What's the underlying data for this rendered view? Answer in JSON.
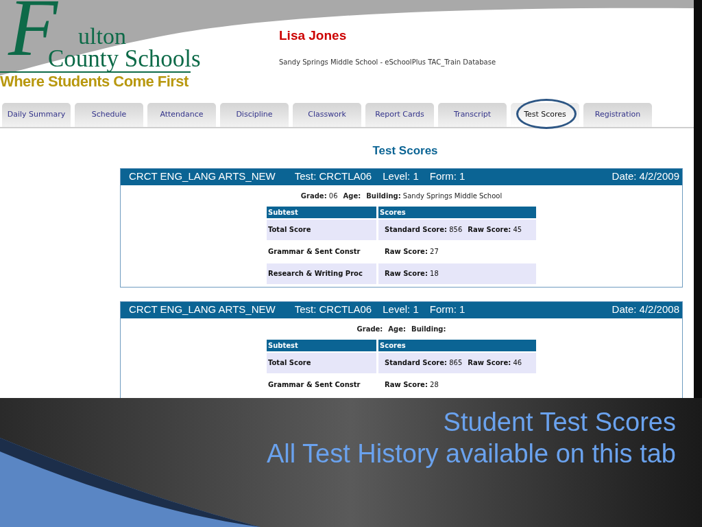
{
  "logo": {
    "initial": "F",
    "name_1": "ulton",
    "name_2": "County Schools",
    "tagline": "Where Students Come First"
  },
  "student": {
    "name": "Lisa Jones",
    "school_line": "Sandy Springs Middle School - eSchoolPlus TAC_Train Database"
  },
  "tabs": [
    {
      "label": "Daily Summary",
      "selected": false
    },
    {
      "label": "Schedule",
      "selected": false
    },
    {
      "label": "Attendance",
      "selected": false
    },
    {
      "label": "Discipline",
      "selected": false
    },
    {
      "label": "Classwork",
      "selected": false
    },
    {
      "label": "Report Cards",
      "selected": false
    },
    {
      "label": "Transcript",
      "selected": false
    },
    {
      "label": "Test Scores",
      "selected": true
    },
    {
      "label": "Registration",
      "selected": false
    }
  ],
  "page_title": "Test Scores",
  "tests": [
    {
      "header": {
        "title": "CRCT ENG_LANG ARTS_NEW",
        "test": "Test: CRCTLA06",
        "level": "Level: 1",
        "form": "Form: 1",
        "date": "Date: 4/2/2009"
      },
      "info": [
        {
          "label": "Grade:",
          "value": "06"
        },
        {
          "label": "Age:"
        },
        {
          "label": "Building:",
          "value": "Sandy Springs Middle School"
        }
      ],
      "columns": [
        "Subtest",
        "Scores"
      ],
      "rows": [
        {
          "subtest": "Total Score",
          "scores": [
            {
              "label": "Standard Score:",
              "value": "856"
            },
            {
              "label": "Raw Score:",
              "value": "45"
            }
          ]
        },
        {
          "subtest": "Grammar & Sent Constr",
          "scores": [
            {
              "label": "Raw Score:",
              "value": "27"
            }
          ]
        },
        {
          "subtest": "Research & Writing Proc",
          "scores": [
            {
              "label": "Raw Score:",
              "value": "18"
            }
          ]
        }
      ]
    },
    {
      "header": {
        "title": "CRCT ENG_LANG ARTS_NEW",
        "test": "Test: CRCTLA06",
        "level": "Level: 1",
        "form": "Form: 1",
        "date": "Date: 4/2/2008"
      },
      "info": [
        {
          "label": "Grade:"
        },
        {
          "label": "Age:"
        },
        {
          "label": "Building:"
        }
      ],
      "columns": [
        "Subtest",
        "Scores"
      ],
      "rows": [
        {
          "subtest": "Total Score",
          "scores": [
            {
              "label": "Standard Score:",
              "value": "865"
            },
            {
              "label": "Raw Score:",
              "value": "46"
            }
          ]
        },
        {
          "subtest": "Grammar & Sent Constr",
          "scores": [
            {
              "label": "Raw Score:",
              "value": "28"
            }
          ]
        }
      ]
    }
  ],
  "caption": [
    "Student Test Scores",
    "All Test History available on this tab"
  ]
}
